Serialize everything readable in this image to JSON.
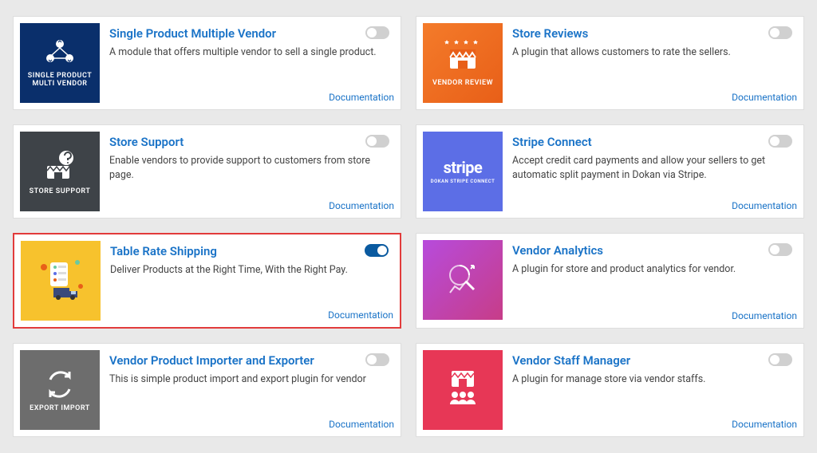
{
  "doc_label": "Documentation",
  "modules": [
    {
      "title": "Single Product Multiple Vendor",
      "desc": "A module that offers multiple vendor to sell a single product.",
      "thumb_label": "SINGLE PRODUCT MULTI VENDOR",
      "enabled": false
    },
    {
      "title": "Store Reviews",
      "desc": "A plugin that allows customers to rate the sellers.",
      "thumb_label": "VENDOR REVIEW",
      "enabled": false
    },
    {
      "title": "Store Support",
      "desc": "Enable vendors to provide support to customers from store page.",
      "thumb_label": "STORE SUPPORT",
      "enabled": false
    },
    {
      "title": "Stripe Connect",
      "desc": "Accept credit card payments and allow your sellers to get automatic split payment in Dokan via Stripe.",
      "thumb_label": "DOKAN STRIPE CONNECT",
      "enabled": false
    },
    {
      "title": "Table Rate Shipping",
      "desc": "Deliver Products at the Right Time, With the Right Pay.",
      "thumb_label": "",
      "enabled": true
    },
    {
      "title": "Vendor Analytics",
      "desc": "A plugin for store and product analytics for vendor.",
      "thumb_label": "",
      "enabled": false
    },
    {
      "title": "Vendor Product Importer and Exporter",
      "desc": "This is simple product import and export plugin for vendor",
      "thumb_label": "EXPORT IMPORT",
      "enabled": false
    },
    {
      "title": "Vendor Staff Manager",
      "desc": "A plugin for manage store via vendor staffs.",
      "thumb_label": "",
      "enabled": false
    }
  ]
}
